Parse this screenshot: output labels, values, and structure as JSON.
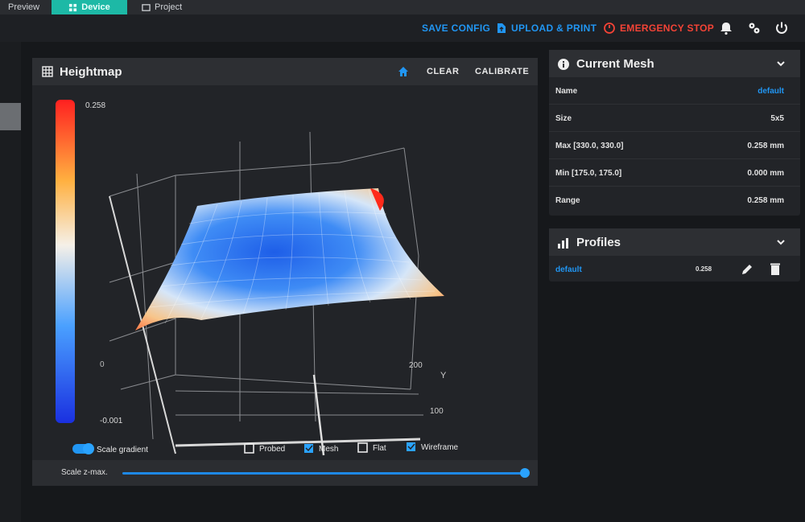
{
  "tabs": [
    {
      "label": "Preview"
    },
    {
      "label": "Device"
    },
    {
      "label": "Project"
    }
  ],
  "appbar": {
    "save_config": "SAVE CONFIG",
    "upload_print": "UPLOAD & PRINT",
    "emergency_stop": "EMERGENCY STOP",
    "icons": [
      "bell-icon",
      "settings-icon",
      "power-icon"
    ]
  },
  "heightmap": {
    "title": "Heightmap",
    "clear": "CLEAR",
    "calibrate": "CALIBRATE",
    "scale_max": "0.258",
    "scale_zero": "0",
    "scale_min": "-0.001",
    "axis_y_label": "Y",
    "tick_200": "200",
    "tick_100": "100",
    "scale_gradient": "Scale gradient",
    "checkboxes": [
      {
        "label": "Probed",
        "checked": false
      },
      {
        "label": "Mesh",
        "checked": true
      },
      {
        "label": "Flat",
        "checked": false
      },
      {
        "label": "Wireframe",
        "checked": true
      }
    ],
    "scale_zmax_label": "Scale z-max.",
    "scale_zmax_fraction": 1.0
  },
  "current_mesh": {
    "title": "Current Mesh",
    "rows": [
      {
        "key": "Name",
        "value": "default"
      },
      {
        "key": "Size",
        "value": "5x5"
      },
      {
        "key": "Max [330.0, 330.0]",
        "value": "0.258 mm"
      },
      {
        "key": "Min [175.0, 175.0]",
        "value": "0.000 mm"
      },
      {
        "key": "Range",
        "value": "0.258 mm"
      }
    ]
  },
  "profiles": {
    "title": "Profiles",
    "items": [
      {
        "name": "default",
        "value": "0.258"
      }
    ]
  },
  "colors": {
    "accent": "#2196f3",
    "device_tab": "#1db9a6",
    "estop": "#f44336"
  }
}
